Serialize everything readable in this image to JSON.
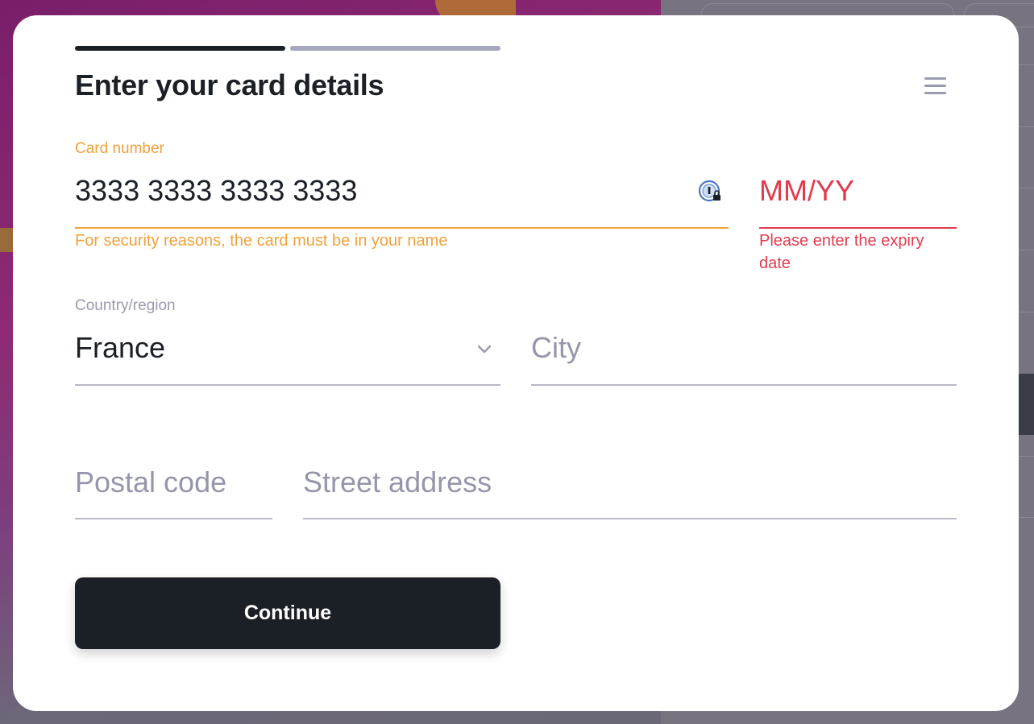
{
  "modal": {
    "title": "Enter your card details",
    "progress": {
      "current_step": 1,
      "total_steps": 2
    },
    "menu_icon": "hamburger-menu-icon"
  },
  "card_number": {
    "label": "Card number",
    "value": "3333 3333 3333 3333",
    "warning": "For security reasons, the card must be in your name",
    "status_color": "#f0a13a",
    "autofill_icon": "password-manager-icon"
  },
  "expiry": {
    "placeholder": "MM/YY",
    "error_line1": "Please enter the expiry",
    "error_line2": "date",
    "status_color": "#e23a4d"
  },
  "country": {
    "label": "Country/region",
    "value": "France",
    "icon": "chevron-down-icon"
  },
  "city": {
    "placeholder": "City"
  },
  "postal_code": {
    "placeholder": "Postal code"
  },
  "street_address": {
    "placeholder": "Street address"
  },
  "continue_button": {
    "label": "Continue"
  },
  "colors": {
    "primary_dark": "#1b1f26",
    "warning": "#f0a13a",
    "error": "#e23a4d",
    "muted": "#9a9aae"
  }
}
